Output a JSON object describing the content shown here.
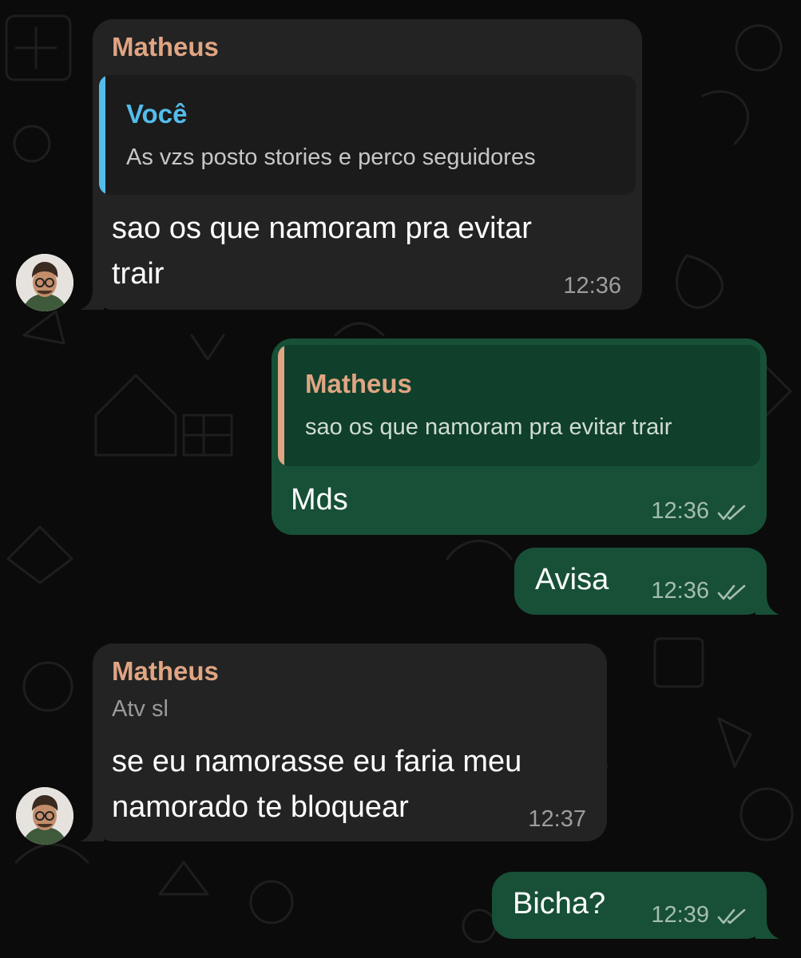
{
  "colors": {
    "background": "#0b0b0b",
    "incoming_bubble": "#232323",
    "outgoing_bubble": "#175037",
    "sender_name": "#e0a583",
    "self_name": "#53bdeb",
    "read_ticks": "#a5bdae"
  },
  "messages": [
    {
      "direction": "incoming",
      "sender": "Matheus",
      "quote": {
        "author": "Você",
        "text": "As vzs posto stories e perco seguidores"
      },
      "lines": [
        "sao os que namoram pra evitar",
        "trair"
      ],
      "time": "12:36",
      "avatar": "avatar"
    },
    {
      "direction": "outgoing",
      "quote": {
        "author": "Matheus",
        "text": "sao os que namoram pra evitar trair"
      },
      "text": "Mds",
      "time": "12:36",
      "status": "read"
    },
    {
      "direction": "outgoing",
      "text": "Avisa",
      "time": "12:36",
      "status": "read"
    },
    {
      "direction": "incoming",
      "sender": "Matheus",
      "subtitle": "Atv sl",
      "lines": [
        "se eu namorasse eu faria meu",
        "namorado te bloquear"
      ],
      "time": "12:37",
      "avatar": "avatar"
    },
    {
      "direction": "outgoing",
      "text": "Bicha?",
      "time": "12:39",
      "status": "read"
    }
  ]
}
